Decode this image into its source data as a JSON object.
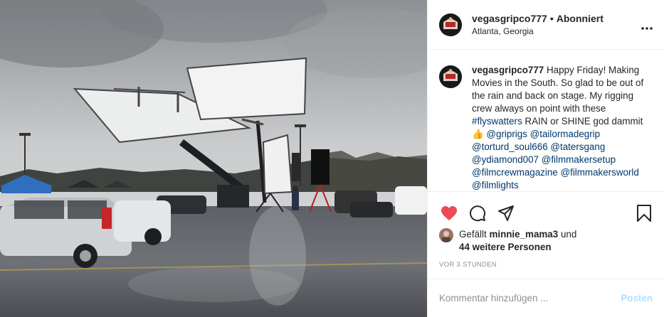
{
  "post": {
    "username": "vegasgripco777",
    "separator": "•",
    "follow_status": "Abonniert",
    "location": "Atlanta, Georgia",
    "more_icon": "more-horizontal-icon"
  },
  "caption": {
    "username": "vegasgripco777",
    "text_1": "Happy Friday! Making Movies in the South. So glad to be out of the rain and back on stage. My rigging crew always on point with these ",
    "hashtag": "#flyswatters",
    "text_2": " RAIN or SHINE god dammit",
    "emoji": "👍",
    "mentions": [
      "@griprigs",
      "@tailormadegrip",
      "@torturd_soul666",
      "@tatersgang",
      "@ydiamond007",
      "@filmmakersetup",
      "@filmcrewmagazine",
      "@filmmakersworld",
      "@filmlights"
    ]
  },
  "actions": {
    "like_icon": "heart-filled-icon",
    "comment_icon": "comment-icon",
    "share_icon": "paper-plane-icon",
    "save_icon": "bookmark-icon",
    "like_color": "#ed4956"
  },
  "likes": {
    "prefix": "Gefällt",
    "user": "minnie_mama3",
    "connector": "und",
    "others": "44 weitere Personen"
  },
  "timestamp": "VOR 3 STUNDEN",
  "comment_box": {
    "placeholder": "Kommentar hinzufügen ...",
    "post_label": "Posten"
  }
}
